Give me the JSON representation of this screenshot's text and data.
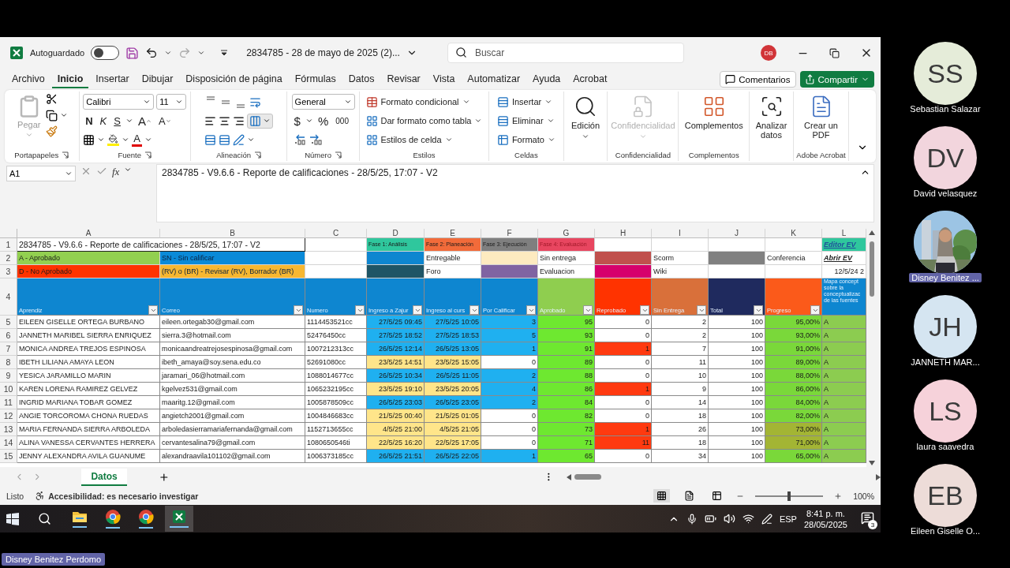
{
  "title_bar": {
    "autosave_label": "Autoguardado",
    "autosave_on": false,
    "document_title": "2834785 - 28 de mayo de 2025 (2)...",
    "search_placeholder": "Buscar",
    "user_initials": "DB"
  },
  "menu_tabs": [
    {
      "label": "Archivo",
      "selected": false
    },
    {
      "label": "Inicio",
      "selected": true
    },
    {
      "label": "Insertar",
      "selected": false
    },
    {
      "label": "Dibujar",
      "selected": false
    },
    {
      "label": "Disposición de página",
      "selected": false
    },
    {
      "label": "Fórmulas",
      "selected": false
    },
    {
      "label": "Datos",
      "selected": false
    },
    {
      "label": "Revisar",
      "selected": false
    },
    {
      "label": "Vista",
      "selected": false
    },
    {
      "label": "Automatizar",
      "selected": false
    },
    {
      "label": "Ayuda",
      "selected": false
    },
    {
      "label": "Acrobat",
      "selected": false
    }
  ],
  "comments_button": "Comentarios",
  "share_button": "Compartir",
  "ribbon": {
    "clipboard": {
      "paste": "Pegar",
      "label": "Portapapeles"
    },
    "font": {
      "name": "Calibri",
      "size": "11",
      "bold": "N",
      "italic": "K",
      "underline": "S",
      "grow": "A",
      "shrink": "A",
      "color_letter": "A",
      "label": "Fuente"
    },
    "alignment": {
      "label": "Alineación"
    },
    "number": {
      "format": "General",
      "currency": "$",
      "percent": "%",
      "thousands": "000",
      "label": "Número"
    },
    "styles": {
      "items": [
        "Formato condicional",
        "Dar formato como tabla",
        "Estilos de celda"
      ],
      "label": "Estilos"
    },
    "cells": {
      "items": [
        "Insertar",
        "Eliminar",
        "Formato"
      ],
      "label": "Celdas"
    },
    "editing": {
      "button": "Edición"
    },
    "sensitivity": {
      "button": "Confidencialidad",
      "label": "Confidencialidad",
      "disabled": true
    },
    "addins": {
      "button": "Complementos",
      "label": "Complementos"
    },
    "analyze": {
      "button": "Analizar datos"
    },
    "acrobat": {
      "button": "Crear un PDF",
      "label": "Adobe Acrobat"
    }
  },
  "formula_bar": {
    "name_box": "A1",
    "function_symbol": "fx",
    "formula": "2834785 - V9.6.6 - Reporte de calificaciones - 28/5/25, 17:07 - V2"
  },
  "sheet": {
    "columns": [
      "A",
      "B",
      "C",
      "D",
      "E",
      "F",
      "G",
      "H",
      "I",
      "J",
      "K",
      "L"
    ],
    "rows": [
      {
        "number": "1",
        "kind": "info",
        "cells": [
          {
            "text": "2834785 - V9.6.6 - Reporte de calificaciones - 28/5/25, 17:07 - V2",
            "kind": "title"
          },
          {},
          {},
          {
            "text": "Fase 1: Análisis",
            "color": "#2fc79d"
          },
          {
            "text": "Fase 2: Planeación",
            "color": "#f26b3a"
          },
          {
            "text": "Fase 3: Ejecución",
            "color": "#7f7f7f"
          },
          {
            "text": "Fase 4: Evaluación",
            "color": "#e84660"
          },
          {},
          {},
          {},
          {},
          {
            "text": "Editor EV",
            "kind": "link",
            "color": "#2fc79d"
          }
        ]
      },
      {
        "number": "2",
        "kind": "info",
        "cells": [
          {
            "text": "A - Aprobado",
            "color": "#92d050"
          },
          {
            "text": "SN - Sin calificar",
            "color": "#0a8ad8"
          },
          {},
          {
            "color": "#0e86d0"
          },
          {
            "text": "Entregable"
          },
          {
            "color": "#fdebc0"
          },
          {
            "text": "Sin entrega"
          },
          {
            "color": "#c0504d"
          },
          {
            "text": "Scorm"
          },
          {
            "color": "#808080"
          },
          {
            "text": "Conferencia"
          },
          {
            "text": "Abrir EV",
            "kind": "link"
          }
        ]
      },
      {
        "number": "3",
        "kind": "info",
        "cells": [
          {
            "text": "D - No Aprobado",
            "color": "#ff3300"
          },
          {
            "text": "(RV) o (BR) - Revisar (RV), Borrador (BR)",
            "color": "#f7b731"
          },
          {},
          {
            "color": "#1f5566"
          },
          {
            "text": "Foro"
          },
          {
            "color": "#8064a2"
          },
          {
            "text": "Evaluacion"
          },
          {
            "color": "#d6006c"
          },
          {
            "text": "Wiki"
          },
          {},
          {},
          {
            "text": "12/5/24 2",
            "kind": "date"
          }
        ]
      },
      {
        "number": "4",
        "kind": "header",
        "cells": [
          {
            "text": "Aprendiz",
            "color": "#0e86d0",
            "filter": true
          },
          {
            "text": "Correo",
            "color": "#0e86d0",
            "filter": true
          },
          {
            "text": "Numero",
            "color": "#0e86d0",
            "filter": true
          },
          {
            "text": "Ingreso a Zajur",
            "color": "#0e86d0",
            "filter": true
          },
          {
            "text": "Ingreso al curs",
            "color": "#0e86d0",
            "filter": true
          },
          {
            "text": "Por Calificar",
            "color": "#0e86d0",
            "filter": true
          },
          {
            "text": "Aprobado",
            "color": "#8fce4f",
            "filter": true
          },
          {
            "text": "Reprobado",
            "color": "#ff3300",
            "filter": true
          },
          {
            "text": "Sin Entrega",
            "color": "#d9703a",
            "filter": true
          },
          {
            "text": "Total",
            "color": "#1f2a5e",
            "filter": true
          },
          {
            "text": "Progreso",
            "color": "#fb5a1a",
            "filter": true
          },
          {
            "text": "Mapa concept\nsobre la\nconceptualizac\nde las fuentes",
            "color": "#0e86d0",
            "filter": false
          }
        ]
      },
      {
        "number": "5",
        "kind": "data",
        "cells": [
          {
            "text": "EILEEN GISELLE ORTEGA BURBANO"
          },
          {
            "text": "eileen.ortegab30@gmail.com"
          },
          {
            "text": "1114453521cc"
          },
          {
            "text": "27/5/25 09:45",
            "color": "#1fb0f0"
          },
          {
            "text": "27/5/25 10:05",
            "color": "#1fb0f0"
          },
          {
            "text": "3",
            "color": "#1fb0f0"
          },
          {
            "text": "95",
            "color": "#6ee830"
          },
          {
            "text": "0"
          },
          {
            "text": "2"
          },
          {
            "text": "100"
          },
          {
            "text": "95,00%",
            "color": "#7ad83a"
          },
          {
            "text": "A",
            "color": "#8ccc50"
          }
        ]
      },
      {
        "number": "6",
        "kind": "data",
        "cells": [
          {
            "text": "JANNETH MARIBEL SIERRA ENRIQUEZ"
          },
          {
            "text": "sierra.3@hotmail.com"
          },
          {
            "text": "52476450cc"
          },
          {
            "text": "27/5/25 18:52",
            "color": "#1fb0f0"
          },
          {
            "text": "27/5/25 18:53",
            "color": "#1fb0f0"
          },
          {
            "text": "5",
            "color": "#1fb0f0"
          },
          {
            "text": "93",
            "color": "#6ee830"
          },
          {
            "text": "0"
          },
          {
            "text": "2"
          },
          {
            "text": "100"
          },
          {
            "text": "93,00%",
            "color": "#7ad83a"
          },
          {
            "text": "A",
            "color": "#8ccc50"
          }
        ]
      },
      {
        "number": "7",
        "kind": "data",
        "cells": [
          {
            "text": "MONICA ANDREA TREJOS ESPINOSA"
          },
          {
            "text": "monicaandreatrejosespinosa@gmail.com"
          },
          {
            "text": "1007212313cc"
          },
          {
            "text": "26/5/25 12:14",
            "color": "#1fb0f0"
          },
          {
            "text": "26/5/25 13:05",
            "color": "#1fb0f0"
          },
          {
            "text": "1",
            "color": "#1fb0f0"
          },
          {
            "text": "91",
            "color": "#6ee830"
          },
          {
            "text": "1",
            "color": "#ff3a10"
          },
          {
            "text": "7"
          },
          {
            "text": "100"
          },
          {
            "text": "91,00%",
            "color": "#7ad83a"
          },
          {
            "text": "A",
            "color": "#8ccc50"
          }
        ]
      },
      {
        "number": "8",
        "kind": "data",
        "cells": [
          {
            "text": "IBETH LILIANA AMAYA LEON"
          },
          {
            "text": "ibeth_amaya@soy.sena.edu.co"
          },
          {
            "text": "52691080cc"
          },
          {
            "text": "23/5/25 14:51",
            "color": "#ffe58a"
          },
          {
            "text": "23/5/25 15:05",
            "color": "#ffe58a"
          },
          {
            "text": "0"
          },
          {
            "text": "89",
            "color": "#6ee830"
          },
          {
            "text": "0"
          },
          {
            "text": "11"
          },
          {
            "text": "100"
          },
          {
            "text": "89,00%",
            "color": "#7ad83a"
          },
          {
            "text": "A",
            "color": "#8ccc50"
          }
        ]
      },
      {
        "number": "9",
        "kind": "data",
        "cells": [
          {
            "text": "YESICA JARAMILLO MARIN"
          },
          {
            "text": "jaramari_06@hotmail.com"
          },
          {
            "text": "1088014677cc"
          },
          {
            "text": "26/5/25 10:34",
            "color": "#1fb0f0"
          },
          {
            "text": "26/5/25 11:05",
            "color": "#1fb0f0"
          },
          {
            "text": "2",
            "color": "#1fb0f0"
          },
          {
            "text": "88",
            "color": "#6ee830"
          },
          {
            "text": "0"
          },
          {
            "text": "10"
          },
          {
            "text": "100"
          },
          {
            "text": "88,00%",
            "color": "#7ad83a"
          },
          {
            "text": "A",
            "color": "#8ccc50"
          }
        ]
      },
      {
        "number": "10",
        "kind": "data",
        "cells": [
          {
            "text": "KAREN LORENA RAMIREZ GELVEZ"
          },
          {
            "text": "kgelvez531@gmail.com"
          },
          {
            "text": "1065232195cc"
          },
          {
            "text": "23/5/25 19:10",
            "color": "#ffe58a"
          },
          {
            "text": "23/5/25 20:05",
            "color": "#ffe58a"
          },
          {
            "text": "4",
            "color": "#1fb0f0"
          },
          {
            "text": "86",
            "color": "#6ee830"
          },
          {
            "text": "1",
            "color": "#ff3a10"
          },
          {
            "text": "9"
          },
          {
            "text": "100"
          },
          {
            "text": "86,00%",
            "color": "#7ad83a"
          },
          {
            "text": "A",
            "color": "#8ccc50"
          }
        ]
      },
      {
        "number": "11",
        "kind": "data",
        "cells": [
          {
            "text": "INGRID MARIANA TOBAR GOMEZ"
          },
          {
            "text": "maaritg.12@gmail.com"
          },
          {
            "text": "1005878509cc"
          },
          {
            "text": "26/5/25 23:03",
            "color": "#1fb0f0"
          },
          {
            "text": "26/5/25 23:05",
            "color": "#1fb0f0"
          },
          {
            "text": "2",
            "color": "#1fb0f0"
          },
          {
            "text": "84",
            "color": "#6ee830"
          },
          {
            "text": "0"
          },
          {
            "text": "14"
          },
          {
            "text": "100"
          },
          {
            "text": "84,00%",
            "color": "#7ad83a"
          },
          {
            "text": "A",
            "color": "#8ccc50"
          }
        ]
      },
      {
        "number": "12",
        "kind": "data",
        "cells": [
          {
            "text": "ANGIE TORCOROMA CHONA RUEDAS"
          },
          {
            "text": "angietch2001@gmail.com"
          },
          {
            "text": "1004846683cc"
          },
          {
            "text": "21/5/25 00:40",
            "color": "#ffe58a"
          },
          {
            "text": "21/5/25 01:05",
            "color": "#ffe58a"
          },
          {
            "text": "0"
          },
          {
            "text": "82",
            "color": "#6ee830"
          },
          {
            "text": "0"
          },
          {
            "text": "18"
          },
          {
            "text": "100"
          },
          {
            "text": "82,00%",
            "color": "#7ad83a"
          },
          {
            "text": "A",
            "color": "#8ccc50"
          }
        ]
      },
      {
        "number": "13",
        "kind": "data",
        "cells": [
          {
            "text": "MARIA FERNANDA SIERRA ARBOLEDA"
          },
          {
            "text": "arboledasierramariafernanda@gmail.com"
          },
          {
            "text": "1152713655cc"
          },
          {
            "text": "4/5/25 21:00",
            "color": "#ffe58a"
          },
          {
            "text": "4/5/25 21:05",
            "color": "#ffe58a"
          },
          {
            "text": "0"
          },
          {
            "text": "73",
            "color": "#6ee830"
          },
          {
            "text": "1",
            "color": "#ff3a10"
          },
          {
            "text": "26"
          },
          {
            "text": "100"
          },
          {
            "text": "73,00%",
            "color": "#a3b534"
          },
          {
            "text": "A",
            "color": "#8ccc50"
          }
        ]
      },
      {
        "number": "14",
        "kind": "data",
        "cells": [
          {
            "text": "ALINA VANESSA CERVANTES HERRERA"
          },
          {
            "text": "cervantesalina79@gmail.com"
          },
          {
            "text": "1080650546ti"
          },
          {
            "text": "22/5/25 16:20",
            "color": "#ffe58a"
          },
          {
            "text": "22/5/25 17:05",
            "color": "#ffe58a"
          },
          {
            "text": "0"
          },
          {
            "text": "71",
            "color": "#6ee830"
          },
          {
            "text": "11",
            "color": "#ff3a10"
          },
          {
            "text": "18"
          },
          {
            "text": "100"
          },
          {
            "text": "71,00%",
            "color": "#a3b534"
          },
          {
            "text": "A",
            "color": "#8ccc50"
          }
        ]
      },
      {
        "number": "15",
        "kind": "data",
        "cells": [
          {
            "text": "JENNY ALEXANDRA AVILA GUANUME"
          },
          {
            "text": "alexandraavila101102@gmail.com"
          },
          {
            "text": "1006373185cc"
          },
          {
            "text": "26/5/25 21:51",
            "color": "#1fb0f0"
          },
          {
            "text": "26/5/25 22:05",
            "color": "#1fb0f0"
          },
          {
            "text": "1",
            "color": "#1fb0f0"
          },
          {
            "text": "65",
            "color": "#6ee830"
          },
          {
            "text": "0"
          },
          {
            "text": "34"
          },
          {
            "text": "100"
          },
          {
            "text": "65,00%",
            "color": "#7ad83a"
          },
          {
            "text": "A",
            "color": "#8ccc50"
          }
        ]
      }
    ]
  },
  "sheet_tabs": [
    {
      "label": "Datos",
      "selected": true
    }
  ],
  "status_bar": {
    "ready": "Listo",
    "accessibility": "Accesibilidad: es necesario investigar",
    "views": [
      {
        "kind": "normal",
        "selected": true
      },
      {
        "kind": "page_layout",
        "selected": false
      },
      {
        "kind": "page_break",
        "selected": false
      }
    ],
    "zoom": {
      "level": 0.5,
      "label": "100%"
    }
  },
  "taskbar": {
    "apps": [
      {
        "kind": "explorer",
        "selected": false
      },
      {
        "kind": "chrome",
        "selected": false
      },
      {
        "kind": "chrome",
        "selected": false
      },
      {
        "kind": "excel",
        "selected": true
      }
    ],
    "language": "ESP",
    "time": "8:41 p. m.",
    "date": "28/05/2025",
    "notifications": "3"
  },
  "participants": [
    {
      "kind": "initials",
      "initials": "SS",
      "name": "Sebastian Salazar",
      "color": "#e5ecd9",
      "highlighted": false
    },
    {
      "kind": "initials",
      "initials": "DV",
      "name": "David velasquez",
      "color": "#f2d5dd",
      "highlighted": false
    },
    {
      "kind": "picture",
      "name": "Disney Benitez ...",
      "highlighted": true
    },
    {
      "kind": "initials",
      "initials": "JH",
      "name": "JANNETH MAR...",
      "color": "#d5e5f1",
      "highlighted": false
    },
    {
      "kind": "initials",
      "initials": "LS",
      "name": "laura saavedra",
      "color": "#f6d2da",
      "highlighted": false
    },
    {
      "kind": "initials",
      "initials": "EB",
      "name": "Eileen Giselle O...",
      "color": "#eddcd8",
      "highlighted": false
    }
  ],
  "presenter_name": "Disney Benitez Perdomo"
}
